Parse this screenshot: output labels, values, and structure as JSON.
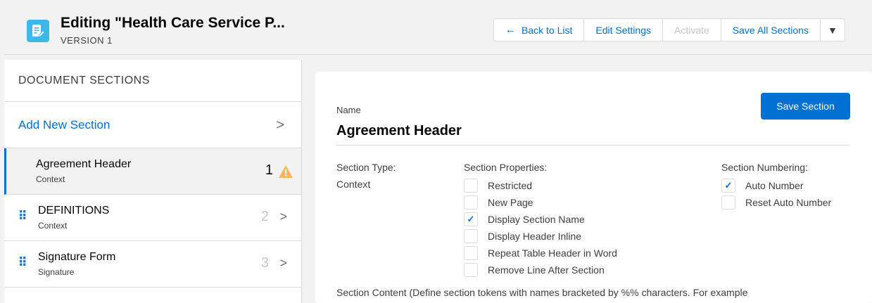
{
  "header": {
    "title": "Editing \"Health Care Service P...",
    "subtitle": "VERSION 1",
    "icon": "document-edit-icon",
    "buttons": {
      "back": "Back to List",
      "edit_settings": "Edit Settings",
      "activate": "Activate",
      "save_all": "Save All Sections"
    }
  },
  "sidebar": {
    "title": "DOCUMENT SECTIONS",
    "add_label": "Add New Section",
    "items": [
      {
        "name": "Agreement Header",
        "type": "Context",
        "number": "1",
        "active": true,
        "warning": true
      },
      {
        "name": "DEFINITIONS",
        "type": "Context",
        "number": "2",
        "active": false
      },
      {
        "name": "Signature Form",
        "type": "Signature",
        "number": "3",
        "active": false
      }
    ]
  },
  "section": {
    "name_label": "Name",
    "name_value": "Agreement Header",
    "save_button": "Save Section",
    "type_label": "Section Type:",
    "type_value": "Context",
    "properties_label": "Section Properties:",
    "properties": [
      {
        "label": "Restricted",
        "checked": false
      },
      {
        "label": "New Page",
        "checked": false
      },
      {
        "label": "Display Section Name",
        "checked": true
      },
      {
        "label": "Display Header Inline",
        "checked": false
      },
      {
        "label": "Repeat Table Header in Word",
        "checked": false
      },
      {
        "label": "Remove Line After Section",
        "checked": false
      }
    ],
    "numbering_label": "Section Numbering:",
    "numbering": [
      {
        "label": "Auto Number",
        "checked": true
      },
      {
        "label": "Reset Auto Number",
        "checked": false
      }
    ],
    "content_label": "Section Content (Define section tokens with names bracketed by %% characters. For example"
  },
  "colors": {
    "brand": "#0070d2",
    "icon_bg": "#3db8e8",
    "warning": "#ffb75d"
  }
}
